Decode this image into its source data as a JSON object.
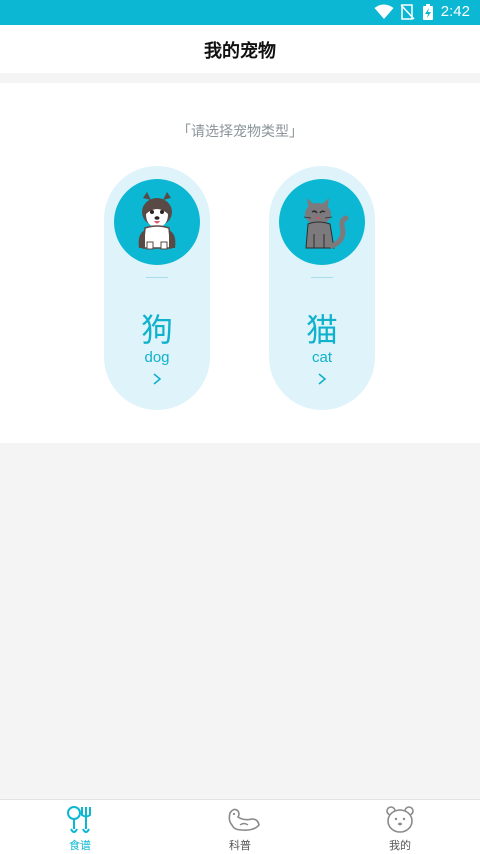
{
  "status_bar": {
    "time": "2:42"
  },
  "header": {
    "title": "我的宠物"
  },
  "main": {
    "prompt": "「请选择宠物类型」",
    "pets": [
      {
        "cn": "狗",
        "en": "dog",
        "icon": "dog-icon"
      },
      {
        "cn": "猫",
        "en": "cat",
        "icon": "cat-icon"
      }
    ]
  },
  "bottom_nav": [
    {
      "label": "食谱",
      "icon": "recipe-icon",
      "active": true
    },
    {
      "label": "科普",
      "icon": "dog-lying-icon",
      "active": false
    },
    {
      "label": "我的",
      "icon": "bear-face-icon",
      "active": false
    }
  ],
  "colors": {
    "accent": "#0bb7d3",
    "card_bg": "#dff4fa",
    "page_bg": "#f4f4f4"
  }
}
